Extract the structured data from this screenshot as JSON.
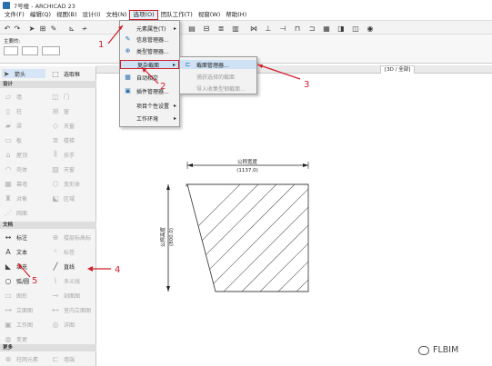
{
  "window": {
    "title": "7号楼 - ARCHICAD 23"
  },
  "menubar": {
    "items": [
      "文件(F)",
      "编辑(Q)",
      "视图(B)",
      "设计(I)",
      "文档(N)",
      "选项(O)",
      "团队工作(T)",
      "视窗(W)",
      "帮助(H)"
    ]
  },
  "infobox": {
    "label": "主要的:"
  },
  "tabs": {
    "tab3d": "[3D / 全部]"
  },
  "toolbox": {
    "arrow": "箭头",
    "marquee": "选取框",
    "design_header": "设计",
    "design_items": [
      "墙",
      "门",
      "柱",
      "窗",
      "梁",
      "天窗",
      "板",
      "楼梯",
      "屋顶",
      "扶手",
      "壳体",
      "天窗",
      "幕墙",
      "变形体",
      "对象",
      "区域",
      "网面"
    ],
    "doc_header": "文档",
    "doc_items": [
      "标注",
      "楼层标高标",
      "文本",
      "标签",
      "填充",
      "直线",
      "弧/圆",
      "多义线",
      "图形",
      "剖面图",
      "立面图",
      "室内立面图",
      "工作图",
      "详图",
      "变更"
    ],
    "more_header": "更多",
    "more_items": [
      "柱网元素",
      "墙端"
    ]
  },
  "dropdown_options": {
    "items": [
      "元素属性(T)",
      "信息管理器...",
      "类型管理器...",
      "复杂截面",
      "自动相交",
      "插件管理器...",
      "项目个性设置",
      "工作环境"
    ]
  },
  "dropdown_complex": {
    "items": [
      "截面管理器...",
      "捕获选择的截面",
      "导入收集型钢截面..."
    ]
  },
  "drawing": {
    "width_label": "公称宽度",
    "width_value": "(1137.0)",
    "height_label": "公称高度",
    "height_value": "(800.0)"
  },
  "annotations": [
    "1",
    "2",
    "3",
    "4",
    "5"
  ],
  "watermark": "FLBIM",
  "colors": {
    "highlight_red": "#d0202a",
    "accent_blue": "#2a6fb0"
  }
}
